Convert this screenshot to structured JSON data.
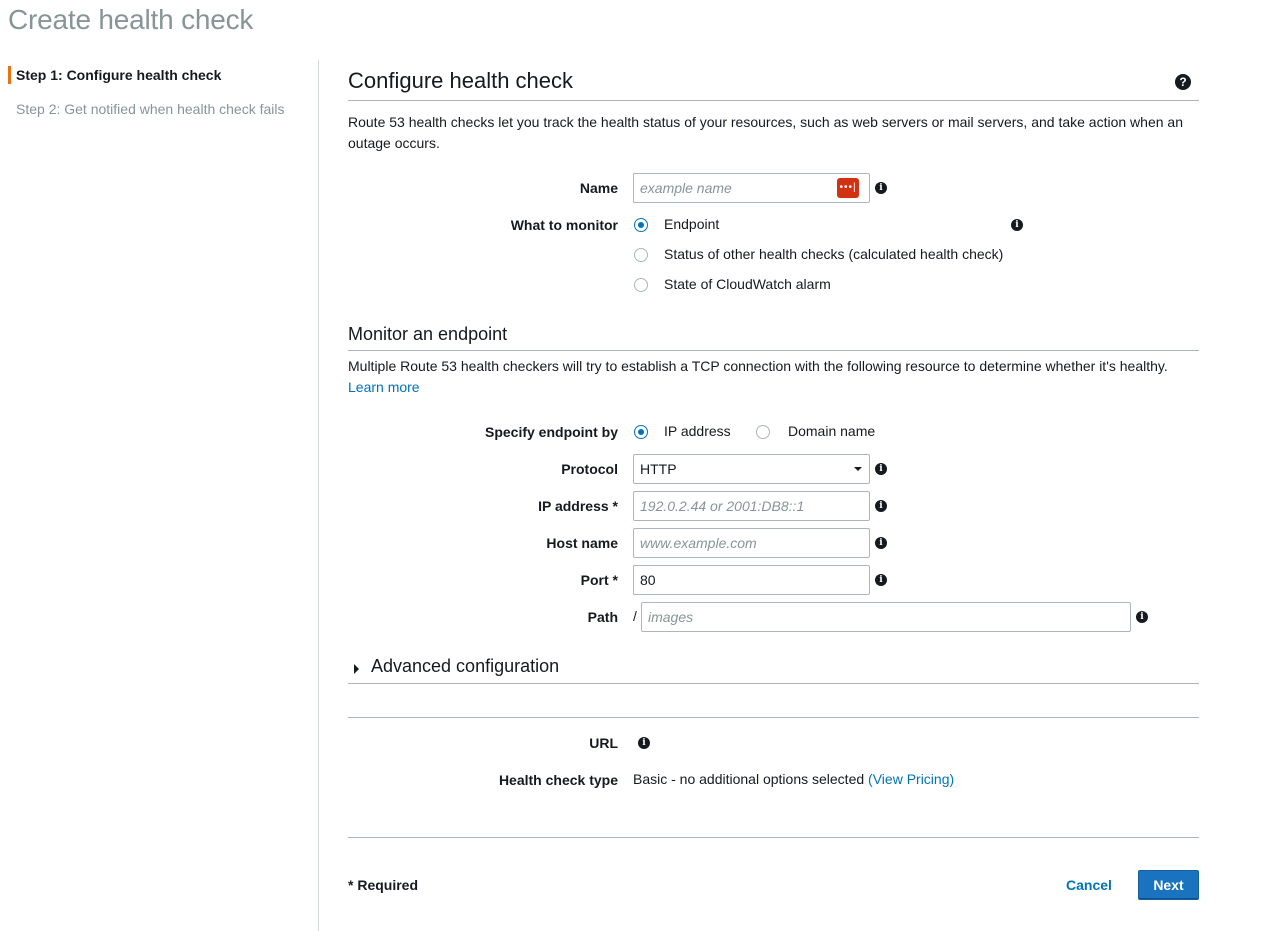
{
  "page": {
    "title": "Create health check"
  },
  "sidebar": {
    "steps": [
      {
        "label": "Step 1: Configure health check",
        "active": true
      },
      {
        "label": "Step 2: Get notified when health check fails",
        "active": false
      }
    ]
  },
  "configure": {
    "heading": "Configure health check",
    "help_icon": "question-circle-icon",
    "description": "Route 53 health checks let you track the health status of your resources, such as web servers or mail servers, and take action when an outage occurs.",
    "name": {
      "label": "Name",
      "placeholder": "example name",
      "value": ""
    },
    "monitor": {
      "label": "What to monitor",
      "options": [
        {
          "label": "Endpoint",
          "checked": true
        },
        {
          "label": "Status of other health checks (calculated health check)",
          "checked": false
        },
        {
          "label": "State of CloudWatch alarm",
          "checked": false
        }
      ]
    }
  },
  "endpoint": {
    "heading": "Monitor an endpoint",
    "description": "Multiple Route 53 health checkers will try to establish a TCP connection with the following resource to determine whether it's healthy.",
    "learn_more": "Learn more",
    "specify_by": {
      "label": "Specify endpoint by",
      "options": [
        {
          "label": "IP address",
          "checked": true
        },
        {
          "label": "Domain name",
          "checked": false
        }
      ]
    },
    "protocol": {
      "label": "Protocol",
      "value": "HTTP"
    },
    "ip_address": {
      "label": "IP address *",
      "placeholder": "192.0.2.44 or 2001:DB8::1",
      "value": ""
    },
    "host_name": {
      "label": "Host name",
      "placeholder": "www.example.com",
      "value": ""
    },
    "port": {
      "label": "Port *",
      "value": "80"
    },
    "path": {
      "label": "Path",
      "prefix": "/",
      "placeholder": "images",
      "value": ""
    }
  },
  "advanced": {
    "label": "Advanced configuration"
  },
  "summary": {
    "url_label": "URL",
    "type_label": "Health check type",
    "type_value": "Basic - no additional options selected",
    "pricing_link": "(View Pricing)"
  },
  "footer": {
    "required_note": "* Required",
    "cancel_label": "Cancel",
    "next_label": "Next"
  },
  "colors": {
    "accent": "#ec7211",
    "link": "#0073bb",
    "primary_button": "#1a73bf"
  }
}
